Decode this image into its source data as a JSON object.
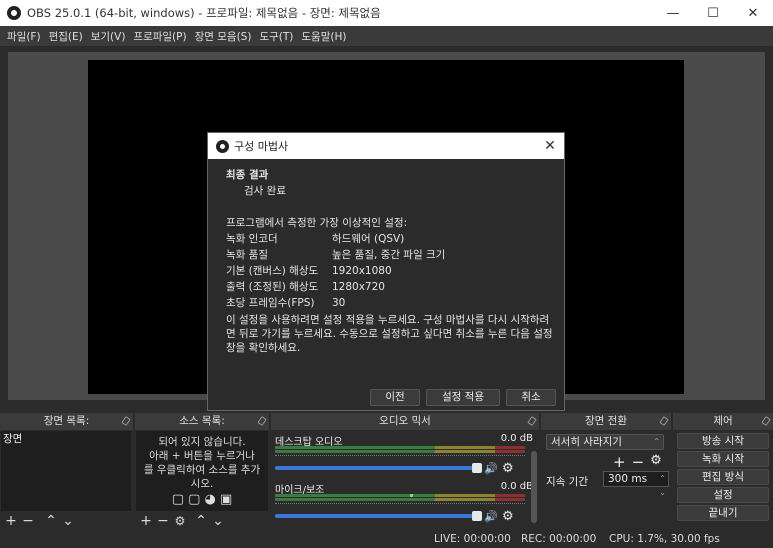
{
  "window": {
    "title": "OBS 25.0.1 (64-bit, windows) - 프로파일: 제목없음 - 장면: 제목없음",
    "minimize": "—",
    "maximize": "☐",
    "close": "✕"
  },
  "menu": [
    "파일(F)",
    "편집(E)",
    "보기(V)",
    "프로파일(P)",
    "장면 모음(S)",
    "도구(T)",
    "도움말(H)"
  ],
  "docks": {
    "scenes": {
      "title": "장면 목록:",
      "items": [
        "장면"
      ]
    },
    "sources": {
      "title": "소스 목록:",
      "empty_text": [
        "되어 있지 않습니다.",
        "아래 + 버튼을 누르거나",
        "를 우클릭하여 소스를 추가",
        "시오."
      ]
    },
    "mixer": {
      "title": "오디오 믹서",
      "channels": [
        {
          "name": "데스크탑 오디오",
          "db": "0.0 dB"
        },
        {
          "name": "마이크/보조",
          "db": "0.0 dB"
        }
      ]
    },
    "transitions": {
      "title": "장면 전환",
      "selected": "서서히 사라지기",
      "duration_label": "지속 기간",
      "duration_value": "300 ms"
    },
    "controls": {
      "title": "제어",
      "buttons": [
        "방송 시작",
        "녹화 시작",
        "편집 방식",
        "설정",
        "끝내기"
      ]
    }
  },
  "status": {
    "live": "LIVE: 00:00:00",
    "rec": "REC: 00:00:00",
    "cpu": "CPU: 1.7%, 30.00 fps"
  },
  "dialog": {
    "title": "구성 마법사",
    "heading": "최종 결과",
    "subheading": "검사 완료",
    "intro": "프로그램에서 측정한 가장 이상적인 설정:",
    "settings": [
      {
        "key": "녹화 인코더",
        "value": "하드웨어 (QSV)"
      },
      {
        "key": "녹화 품질",
        "value": "높은 품질, 중간 파일 크기"
      },
      {
        "key": "기본 (캔버스) 해상도",
        "value": "1920x1080"
      },
      {
        "key": "출력 (조정된) 해상도",
        "value": "1280x720"
      },
      {
        "key": "초당 프레임수(FPS)",
        "value": "30"
      }
    ],
    "note": "이 설정을 사용하려면 설정 적용을 누르세요. 구성 마법사를 다시 시작하려면 뒤로 가기를 누르세요. 수동으로 설정하고 싶다면 취소를 누른 다음 설정 창을 확인하세요.",
    "buttons": {
      "back": "이전",
      "apply": "설정 적용",
      "cancel": "취소"
    }
  },
  "colors": {
    "meter_green": "#3d9a3d",
    "meter_yellow": "#a09a30",
    "meter_red": "#9a3a3a",
    "volume_blue": "#3b78d8"
  }
}
